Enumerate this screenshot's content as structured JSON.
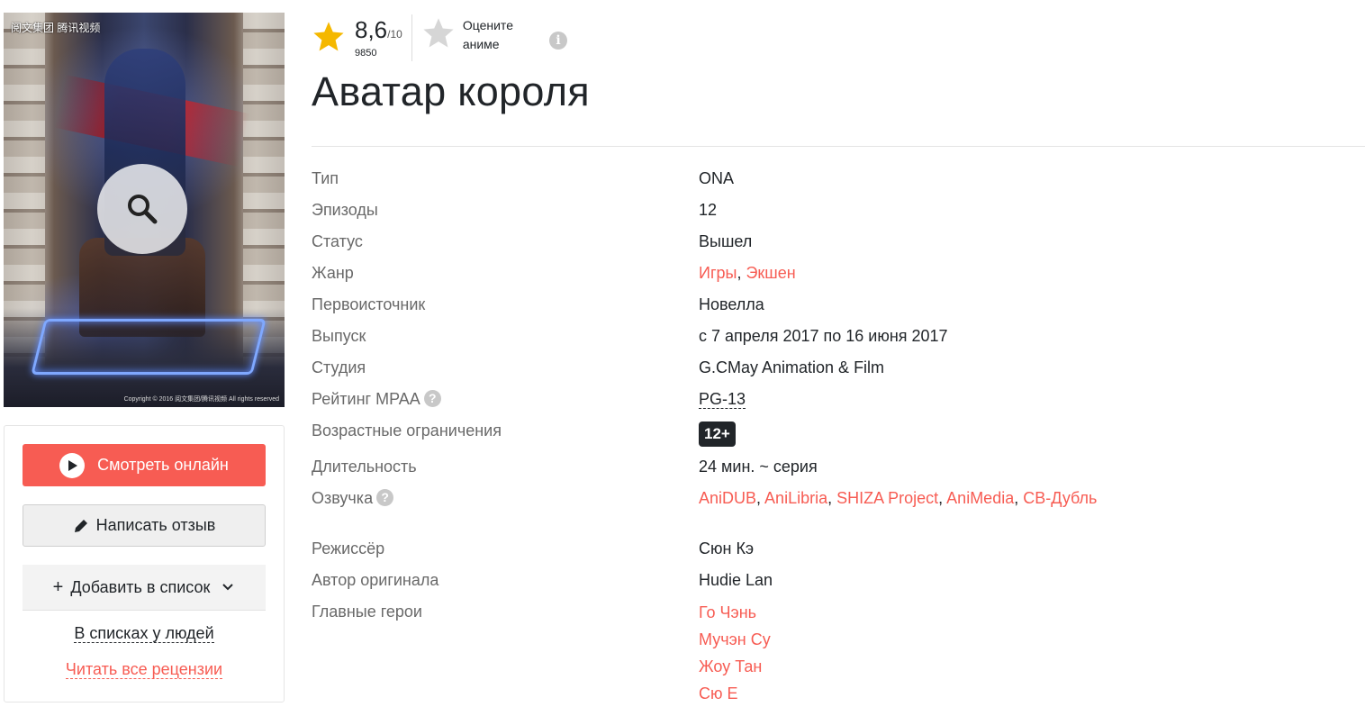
{
  "poster": {
    "brand_text": "阅文集团 腾讯视频",
    "copyright_text": "Copyright © 2016 阅文集团/腾讯视频 All rights reserved"
  },
  "actions": {
    "watch_label": "Смотреть онлайн",
    "review_label": "Написать отзыв",
    "addlist_label": "Добавить в список",
    "lists_link": "В списках у людей",
    "reviews_link": "Читать все рецензии"
  },
  "rating": {
    "score": "8,6",
    "scale": "/10",
    "votes": "9850",
    "rate_line1": "Оцените",
    "rate_line2": "аниме"
  },
  "title": "Аватар короля",
  "info": {
    "type": {
      "label": "Тип",
      "value": "ONA"
    },
    "episodes": {
      "label": "Эпизоды",
      "value": "12"
    },
    "status": {
      "label": "Статус",
      "value": "Вышел"
    },
    "genre": {
      "label": "Жанр",
      "values": [
        "Игры",
        "Экшен"
      ]
    },
    "source": {
      "label": "Первоисточник",
      "value": "Новелла"
    },
    "release": {
      "label": "Выпуск",
      "value": "с 7 апреля 2017 по 16 июня 2017"
    },
    "studio": {
      "label": "Студия",
      "value": "G.CMay Animation & Film"
    },
    "mpaa": {
      "label": "Рейтинг MPAA",
      "value": "PG-13"
    },
    "age": {
      "label": "Возрастные ограничения",
      "value": "12+"
    },
    "duration": {
      "label": "Длительность",
      "value": "24 мин. ~ серия"
    },
    "dubbing": {
      "label": "Озвучка",
      "values": [
        "AniDUB",
        "AniLibria",
        "SHIZA Project",
        "AniMedia",
        "СВ-Дубль"
      ]
    },
    "director": {
      "label": "Режиссёр",
      "value": "Сюн Кэ"
    },
    "author": {
      "label": "Автор оригинала",
      "value": "Hudie Lan"
    },
    "heroes": {
      "label": "Главные герои",
      "values": [
        "Го Чэнь",
        "Мучэн Су",
        "Жоу Тан",
        "Сю Е"
      ]
    }
  },
  "colors": {
    "accent": "#f75c53",
    "text": "#212529",
    "label": "#696969"
  }
}
